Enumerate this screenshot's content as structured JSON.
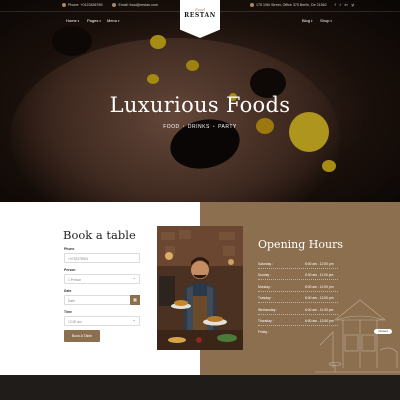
{
  "topbar": {
    "phone": "Phone: +0123456789",
    "email": "Email: food@restan.com",
    "address": "175 10th Street, Office 375 Berlin, De 21562",
    "social": [
      "f",
      "t",
      "in",
      "yt"
    ]
  },
  "nav": {
    "left": [
      {
        "label": "Home"
      },
      {
        "label": "Pages"
      },
      {
        "label": "Menu"
      }
    ],
    "right": [
      {
        "label": "Blog"
      },
      {
        "label": "Shop"
      }
    ]
  },
  "logo": {
    "script": "Food",
    "name": "RESTAN"
  },
  "hero": {
    "title": "Luxurious Foods",
    "subtitle": [
      "FOOD",
      "DRINKS",
      "PARTY"
    ]
  },
  "booking": {
    "title": "Book a table",
    "fields": [
      {
        "label": "Phone",
        "placeholder": "+4733378901"
      },
      {
        "label": "Person",
        "placeholder": "1 Person"
      },
      {
        "label": "Date",
        "placeholder": "Date"
      },
      {
        "label": "Time",
        "placeholder": "12:00 am"
      }
    ],
    "button": "Book A Table"
  },
  "hours": {
    "title": "Opening Hours",
    "rows": [
      {
        "day": "Saturday :",
        "time": "6:00 am - 12:00 pm"
      },
      {
        "day": "Sunday :",
        "time": "6:30 am - 11:00 pm"
      },
      {
        "day": "Monday :",
        "time": "8:00 am - 12:00 pm"
      },
      {
        "day": "Tuesday :",
        "time": "6:00 am - 12:00 pm"
      },
      {
        "day": "Wednesday :",
        "time": "6:00 am - 11:30 pm"
      },
      {
        "day": "Thursday :",
        "time": "6:00 am - 12:00 pm"
      },
      {
        "day": "Friday :",
        "time": ""
      }
    ],
    "closed": "Closed"
  },
  "colors": {
    "accent": "#8c6f4e",
    "hero_dark": "#1a1714",
    "white": "#ffffff"
  },
  "icons": [
    "phone-icon",
    "email-icon",
    "location-icon",
    "calendar-icon",
    "caret-down-icon"
  ]
}
